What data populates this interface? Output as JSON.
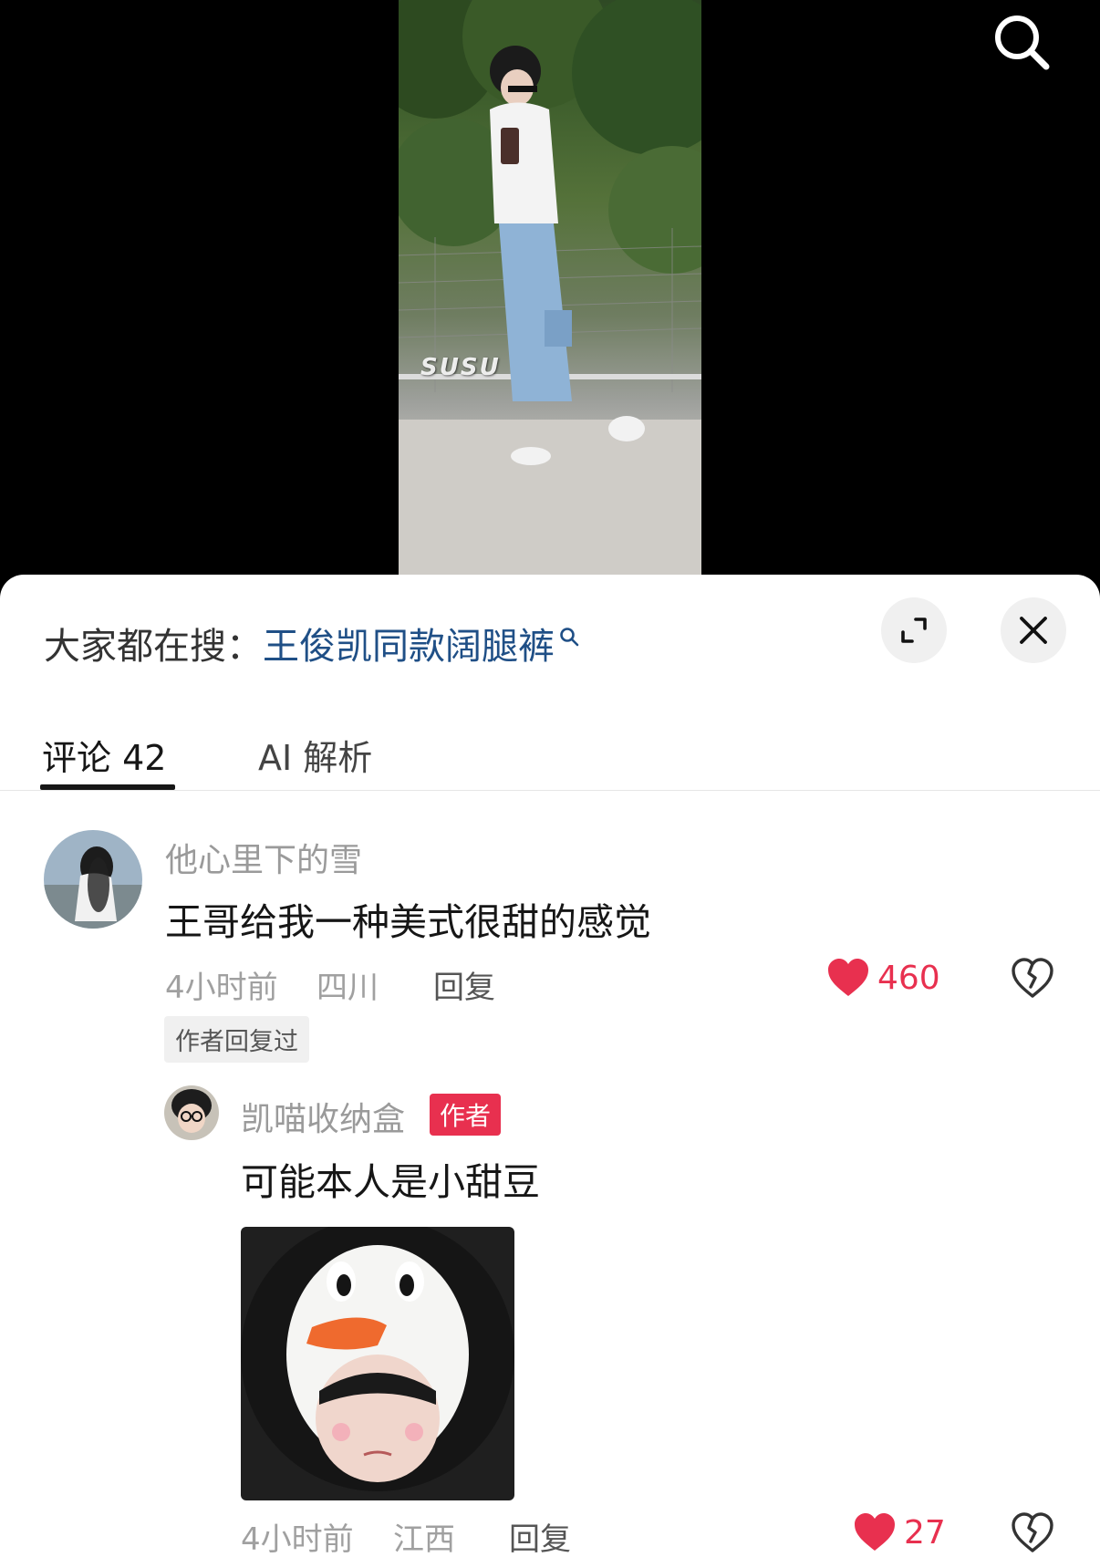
{
  "icons": {
    "search": "search-icon",
    "keyword_search": "magnifier-icon",
    "expand": "expand-icon",
    "close": "close-icon",
    "like": "heart-icon",
    "dislike": "broken-heart-icon"
  },
  "colors": {
    "accent_red": "#e8304f",
    "keyword_blue": "#1f4f86"
  },
  "video": {
    "watermark": "SUSU"
  },
  "hot_search": {
    "prefix": "大家都在搜：",
    "keyword": "王俊凯同款阔腿裤"
  },
  "tabs": [
    {
      "label": "评论 42",
      "active": true
    },
    {
      "label": "AI 解析",
      "active": false
    }
  ],
  "comments": [
    {
      "username": "他心里下的雪",
      "text": "王哥给我一种美式很甜的感觉",
      "time": "4小时前",
      "location": "四川",
      "reply_label": "回复",
      "likes": "460",
      "author_replied": "作者回复过",
      "replies": [
        {
          "username": "凯喵收纳盒",
          "badge": "作者",
          "text": "可能本人是小甜豆",
          "time": "4小时前",
          "location": "江西",
          "reply_label": "回复",
          "likes": "27"
        }
      ]
    }
  ]
}
